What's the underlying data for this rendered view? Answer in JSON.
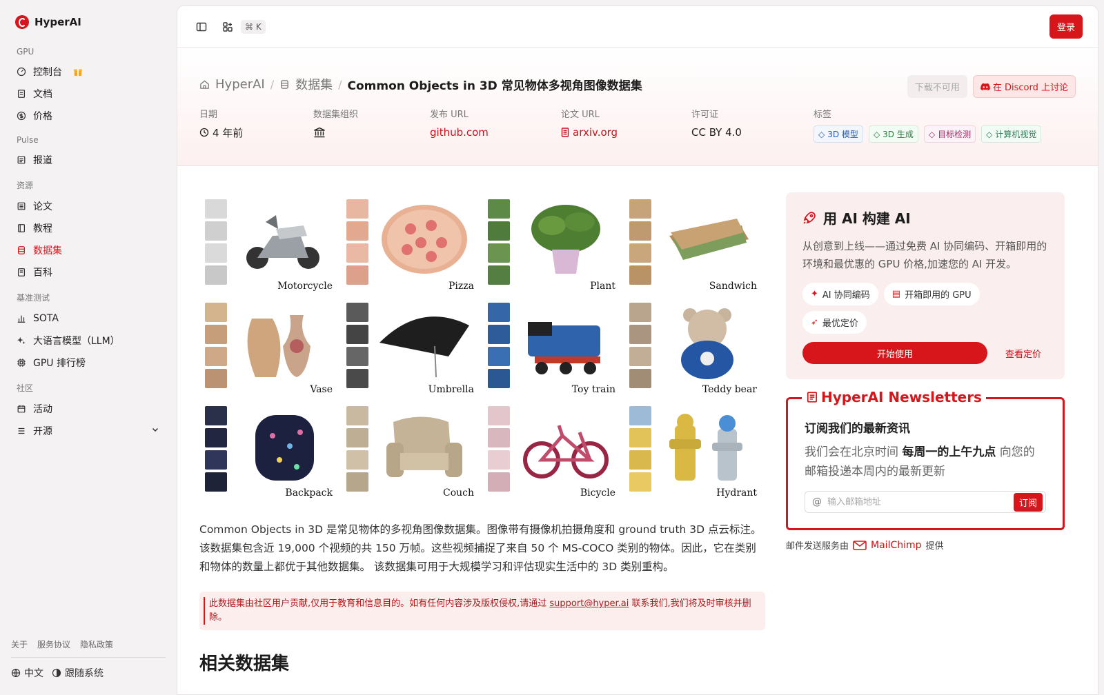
{
  "brand": {
    "name": "HyperAI"
  },
  "sidebar": {
    "groups": [
      {
        "title": "GPU",
        "items": [
          {
            "label": "控制台"
          },
          {
            "label": "文档"
          },
          {
            "label": "价格"
          }
        ]
      },
      {
        "title": "Pulse",
        "items": [
          {
            "label": "报道"
          }
        ]
      },
      {
        "title": "资源",
        "items": [
          {
            "label": "论文"
          },
          {
            "label": "教程"
          },
          {
            "label": "数据集"
          },
          {
            "label": "百科"
          }
        ]
      },
      {
        "title": "基准测试",
        "items": [
          {
            "label": "SOTA"
          },
          {
            "label": "大语言模型（LLM）"
          },
          {
            "label": "GPU 排行榜"
          }
        ]
      },
      {
        "title": "社区",
        "items": [
          {
            "label": "活动"
          },
          {
            "label": "开源"
          }
        ]
      }
    ],
    "footer_links": {
      "about": "关于",
      "terms": "服务协议",
      "privacy": "隐私政策"
    },
    "language": "中文",
    "theme": "跟随系统"
  },
  "topbar": {
    "shortcut": "⌘ K",
    "login": "登录"
  },
  "breadcrumb": {
    "home": "HyperAI",
    "section": "数据集",
    "current": "Common Objects in 3D 常见物体多视角图像数据集"
  },
  "hero_actions": {
    "download": "下载不可用",
    "discord": "在 Discord 上讨论"
  },
  "meta": {
    "date_label": "日期",
    "date_value": "4 年前",
    "org_label": "数据集组织",
    "publish_label": "发布 URL",
    "publish_value": "github.com",
    "paper_label": "论文 URL",
    "paper_value": "arxiv.org",
    "license_label": "许可证",
    "license_value": "CC BY 4.0",
    "tags_label": "标签",
    "tags": [
      "3D 模型",
      "3D 生成",
      "目标检测",
      "计算机视觉"
    ]
  },
  "figure": {
    "captions": [
      "Motorcycle",
      "Pizza",
      "Plant",
      "Sandwich",
      "Vase",
      "Umbrella",
      "Toy train",
      "Teddy bear",
      "Backpack",
      "Couch",
      "Bicycle",
      "Hydrant"
    ]
  },
  "description": "Common Objects in 3D 是常见物体的多视角图像数据集。图像带有摄像机拍摄角度和 ground truth 3D 点云标注。该数据集包含近 19,000 个视频的共 150 万帧。这些视频捕捉了来自 50 个 MS-COCO 类别的物体。因此，它在类别和物体的数量上都优于其他数据集。 该数据集可用于大规模学习和评估现实生活中的 3D 类别重构。",
  "notice": {
    "before": "此数据集由社区用户贡献,仅用于教育和信息目的。如有任何内容涉及版权侵权,请通过 ",
    "email": "support@hyper.ai",
    "after": " 联系我们,我们将及时审核并删除。"
  },
  "related_title": "相关数据集",
  "promo": {
    "title": "用 AI 构建 AI",
    "desc": "从创意到上线——通过免费 AI 协同编码、开箱即用的环境和最优惠的 GPU 价格,加速您的 AI 开发。",
    "chips": [
      "AI 协同编码",
      "开箱即用的 GPU",
      "最优定价"
    ],
    "start": "开始使用",
    "pricing": "查看定价"
  },
  "newsletter": {
    "legend": "HyperAI Newsletters",
    "title": "订阅我们的最新资讯",
    "desc_before": "我们会在北京时间 ",
    "desc_bold": "每周一的上午九点",
    "desc_after": " 向您的邮箱投递本周内的最新更新",
    "placeholder": "输入邮箱地址",
    "subscribe": "订阅",
    "note_before": "邮件发送服务由",
    "note_brand": "MailChimp",
    "note_after": "提供"
  },
  "colors": {
    "accent": "#d7161c"
  }
}
